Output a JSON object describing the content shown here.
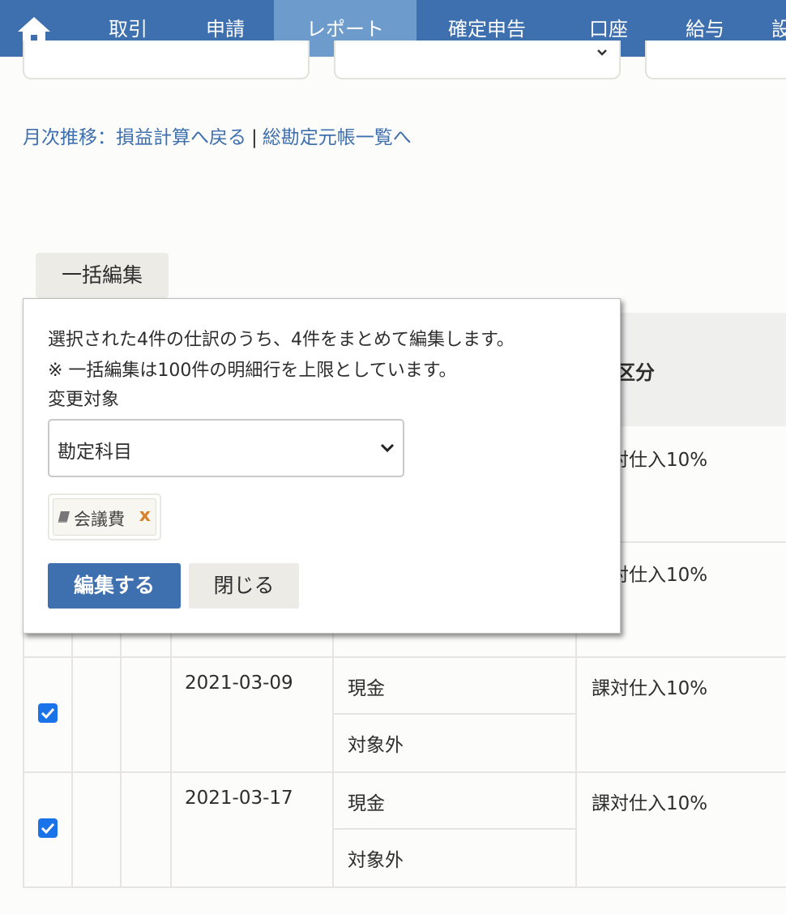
{
  "nav": {
    "items": [
      {
        "label": "取引"
      },
      {
        "label": "申請"
      },
      {
        "label": "レポート"
      },
      {
        "label": "確定申告"
      },
      {
        "label": "口座"
      },
      {
        "label": "給与"
      },
      {
        "label": "設"
      }
    ],
    "active_index": 2,
    "home_icon": "home-icon",
    "bar_color": "#3e6fae",
    "active_color": "#6d9bcc"
  },
  "links": {
    "back": "月次推移：損益計算へ戻る",
    "separator": "|",
    "ledger": "総勘定元帳一覧へ"
  },
  "bulk_edit_button": "一括編集",
  "popup": {
    "message_1": "選択された4件の仕訳のうち、4件をまとめて編集します。",
    "message_2": "※ 一括編集は100件の明細行を上限としています。",
    "target_label": "変更対象",
    "select_value": "勘定科目",
    "tag_label": "会議費",
    "tag_remove": "x",
    "edit_button": "編集する",
    "close_button": "閉じる"
  },
  "table": {
    "header_partial": "区分",
    "rows": [
      {
        "tax": "課対仕入10%"
      },
      {
        "tax": "課対仕入10%"
      },
      {
        "date": "2021-03-09",
        "account": "現金",
        "sub": "対象外",
        "tax": "課対仕入10%",
        "checked": true
      },
      {
        "date": "2021-03-17",
        "account": "現金",
        "sub": "対象外",
        "tax": "課対仕入10%",
        "checked": true
      }
    ]
  },
  "colors": {
    "primary": "#3e6fae",
    "checkbox": "#1a73e8",
    "remove": "#d9822b"
  }
}
